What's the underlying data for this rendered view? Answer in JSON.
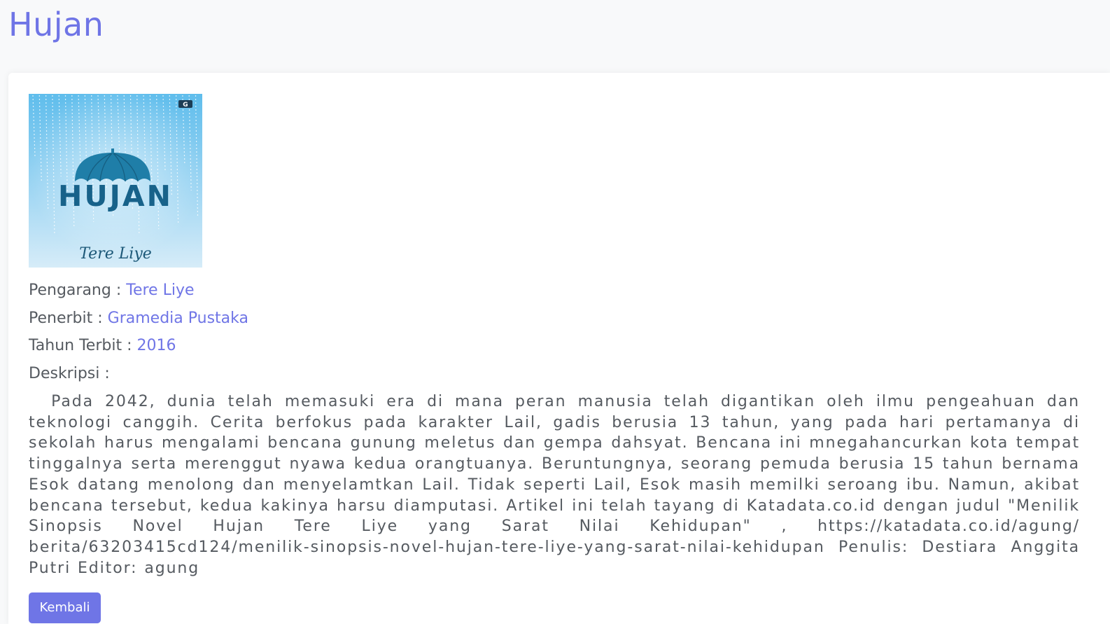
{
  "page": {
    "title": "Hujan"
  },
  "book": {
    "cover": {
      "title_text": "HUJAN",
      "author_text": "Tere Liye",
      "publisher_logo": "G",
      "colors": {
        "sky_top": "#6fc4ee",
        "sky_bottom": "#cfe9f7",
        "umbrella": "#1f7ea8",
        "title": "#17628a"
      }
    },
    "fields": [
      {
        "label": "Pengarang : ",
        "value": "Tere Liye"
      },
      {
        "label": "Penerbit : ",
        "value": "Gramedia Pustaka"
      },
      {
        "label": "Tahun Terbit : ",
        "value": "2016"
      }
    ],
    "description_label": "Deskripsi :",
    "description": "Pada 2042, dunia telah memasuki era di mana peran manusia telah digantikan oleh ilmu pengeahuan dan teknologi canggih. Cerita berfokus pada karakter Lail, gadis berusia 13 tahun, yang pada hari pertamanya di sekolah harus mengalami bencana gunung meletus dan gempa dahsyat. Bencana ini mnegahancurkan kota tempat tinggalnya serta merenggut nyawa kedua orangtuanya. Beruntungnya, seorang pemuda berusia 15 tahun bernama Esok datang menolong dan menyelamtkan Lail. Tidak seperti Lail, Esok masih memilki seroang ibu. Namun, akibat bencana tersebut, kedua kakinya harsu diamputasi. Artikel ini telah tayang di Katadata.co.id dengan judul \"Menilik Sinopsis Novel Hujan Tere Liye yang Sarat Nilai Kehidupan\" , https://katadata.co.id/agung/ berita/63203415cd124/menilik-sinopsis-novel-hujan-tere-liye-yang-sarat-nilai-kehidupan Penulis: Destiara Anggita Putri Editor: agung"
  },
  "actions": {
    "back_label": "Kembali"
  },
  "theme": {
    "accent": "#6f75e6",
    "text": "#555a60",
    "background": "#f8f9fa"
  }
}
